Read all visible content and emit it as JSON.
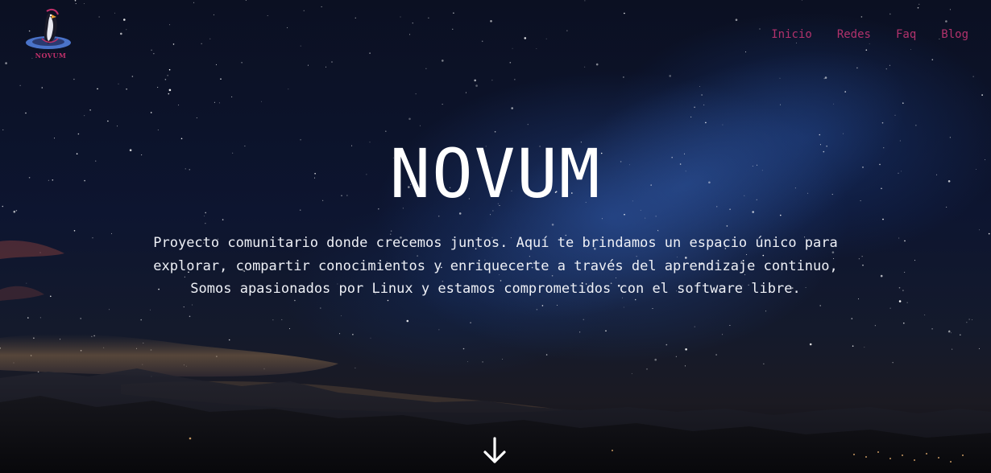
{
  "header": {
    "logo_text": "NOVUM",
    "nav": [
      {
        "label": "Inicio"
      },
      {
        "label": "Redes"
      },
      {
        "label": "Faq"
      },
      {
        "label": "Blog"
      }
    ]
  },
  "hero": {
    "title": "NOVUM",
    "description": "Proyecto comunitario donde crecemos juntos. Aquí te brindamos un espacio único para explorar, compartir conocimientos y enriquecerte a través del aprendizaje continuo, Somos apasionados por Linux y estamos comprometidos con el software libre."
  },
  "icons": {
    "scroll": "arrow-down-icon",
    "logo": "penguin-logo-icon"
  },
  "colors": {
    "nav": "#b2326c",
    "logo_accent": "#c0306a",
    "logo_blue": "#4a73c9",
    "hero_text": "#ffffff"
  }
}
